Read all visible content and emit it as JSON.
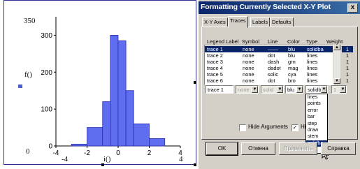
{
  "worksheet": {
    "y_label": "f()",
    "x_label": "i()",
    "y_value_label": "350",
    "x_left_value": "-4",
    "x_right_value": "4",
    "y_bottom_value": "0"
  },
  "chart_data": {
    "type": "bar",
    "x": [
      -3.0,
      -2.0,
      -1.0,
      -0.5,
      0.0,
      0.5,
      1.0,
      2.0
    ],
    "values": [
      5,
      50,
      120,
      300,
      285,
      150,
      60,
      20
    ],
    "bin_width": 1.0,
    "xlim": [
      -4,
      4
    ],
    "ylim": [
      0,
      350
    ],
    "xticks": [
      "-4",
      "-2",
      "0",
      "2",
      "4"
    ],
    "yticks": [
      "0",
      "100",
      "200",
      "300"
    ],
    "xlabel": "i()",
    "ylabel": "",
    "grid": false,
    "series_color": "#5f6ef0"
  },
  "dialog": {
    "title": "Formatting Currently Selected X-Y Plot",
    "close_label": "x",
    "tabs": [
      "X-Y Axes",
      "Traces",
      "Labels",
      "Defaults"
    ],
    "columns": [
      "Legend Label",
      "Symbol",
      "Line",
      "Color",
      "Type",
      "Weight"
    ],
    "rows": [
      {
        "label": "trace 1",
        "symbol": "none",
        "line": "——",
        "color": "blu",
        "type": "solidba"
      },
      {
        "label": "trace 2",
        "symbol": "none",
        "line": "dot",
        "color": "blu",
        "type": "lines"
      },
      {
        "label": "trace 3",
        "symbol": "none",
        "line": "dash",
        "color": "grn",
        "type": "lines"
      },
      {
        "label": "trace 4",
        "symbol": "none",
        "line": "dadot",
        "color": "mag",
        "type": "lines"
      },
      {
        "label": "trace 5",
        "symbol": "none",
        "line": "solic",
        "color": "cya",
        "type": "lines"
      },
      {
        "label": "trace 6",
        "symbol": "none",
        "line": "dot",
        "color": "bro",
        "type": "lines"
      }
    ],
    "weights": [
      "1",
      "1",
      "1",
      "1",
      "1",
      "1"
    ],
    "editor": {
      "label": "trace 1",
      "symbol": "none",
      "line": "solid",
      "color": "blu",
      "type": "solidba",
      "weight": "1"
    },
    "hide_arguments_label": "Hide Arguments",
    "hide_legend_label": "Hi",
    "type_options": [
      "lines",
      "points",
      "error",
      "bar",
      "step",
      "draw",
      "stem",
      "solidba"
    ],
    "buttons": {
      "ok": "OK",
      "cancel": "Отмена",
      "apply": "Применить",
      "help": "Справка"
    }
  }
}
